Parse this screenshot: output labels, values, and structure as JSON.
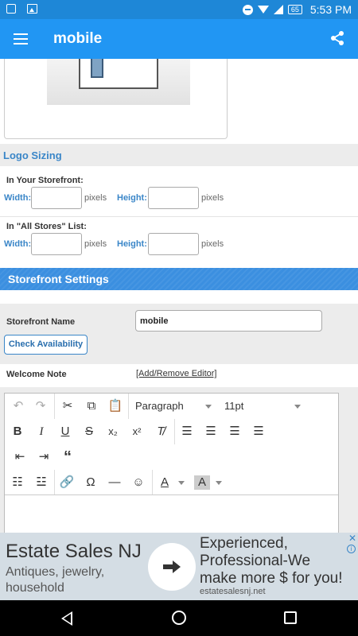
{
  "status_bar": {
    "time": "5:53 PM",
    "battery": "65"
  },
  "app_bar": {
    "title": "mobile",
    "menu_icon": "hamburger-menu-icon",
    "share_icon": "share-icon"
  },
  "logo_sizing": {
    "title": "Logo Sizing",
    "storefront": {
      "label": "In Your Storefront:",
      "width_label": "Width:",
      "height_label": "Height:",
      "unit": "pixels",
      "width_value": "",
      "height_value": ""
    },
    "all_stores": {
      "label": "In \"All Stores\" List:",
      "width_label": "Width:",
      "height_label": "Height:",
      "unit": "pixels",
      "width_value": "",
      "height_value": ""
    }
  },
  "storefront_settings": {
    "title": "Storefront Settings",
    "name_label": "Storefront Name",
    "name_value": "mobile",
    "check_button": "Check Availability",
    "welcome_label": "Welcome Note",
    "editor_link": "[Add/Remove Editor]"
  },
  "editor": {
    "format": "Paragraph",
    "font_size": "11pt",
    "icons": [
      "undo-icon",
      "redo-icon",
      "cut-icon",
      "copy-icon",
      "paste-icon",
      "bold-icon",
      "italic-icon",
      "underline-icon",
      "strikethrough-icon",
      "subscript-icon",
      "superscript-icon",
      "clear-format-icon",
      "align-left-icon",
      "align-center-icon",
      "align-right-icon",
      "justify-icon",
      "outdent-icon",
      "indent-icon",
      "blockquote-icon",
      "bullet-list-icon",
      "numbered-list-icon",
      "link-icon",
      "special-char-icon",
      "horizontal-rule-icon",
      "emoticon-icon",
      "text-color-icon",
      "background-color-icon"
    ]
  },
  "ad": {
    "headline": "Estate Sales NJ",
    "subtext": "Antiques, jewelry, household",
    "right_text": "Experienced, Professional-We make more $ for you!",
    "url": "estatesalesnj.net"
  }
}
